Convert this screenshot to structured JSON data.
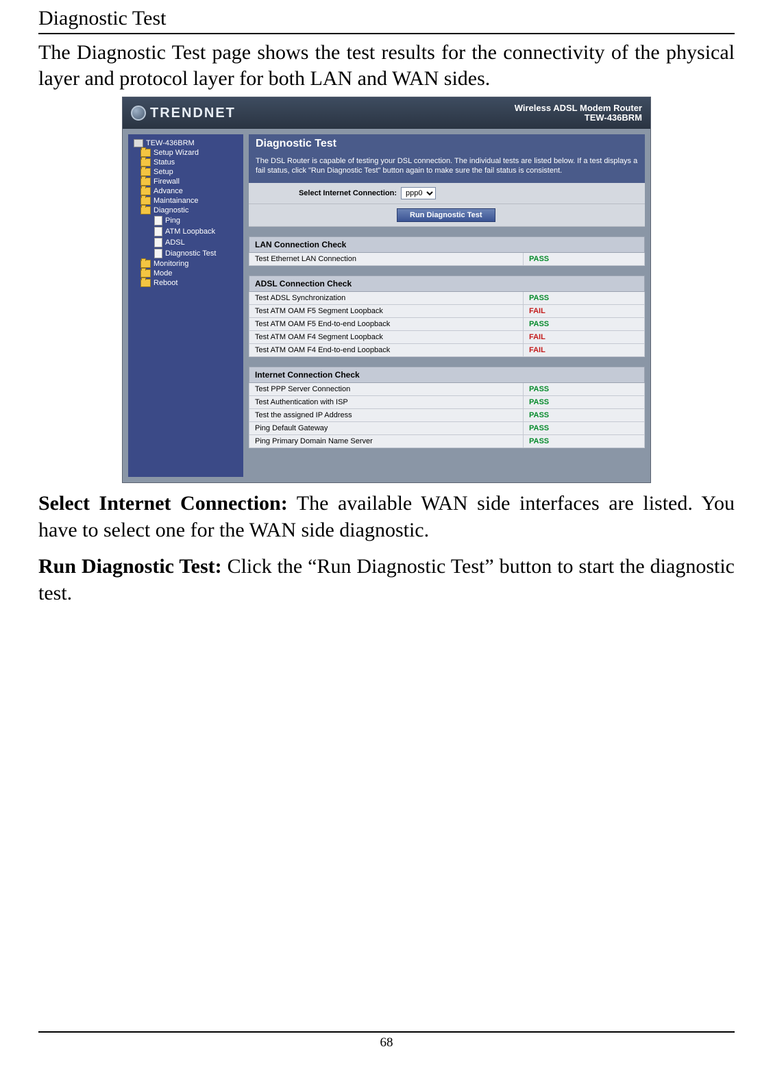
{
  "doc": {
    "section_heading": "Diagnostic Test",
    "intro": "The Diagnostic Test page shows the test results for the connectivity of the physical layer and protocol layer for both LAN and WAN sides.",
    "def1_term": "Select Internet Connection:",
    "def1_text": " The available WAN side interfaces are listed. You have to select one for the WAN side diagnostic.",
    "def2_term": "Run Diagnostic Test:",
    "def2_text": " Click the “Run Diagnostic Test” button to start the diagnostic test.",
    "page_number": "68"
  },
  "router": {
    "brand": "TRENDNET",
    "product_line1": "Wireless ADSL Modem Router",
    "product_line2": "TEW-436BRM",
    "nav": {
      "root": "TEW-436BRM",
      "items": [
        {
          "label": "Setup Wizard",
          "level": 1,
          "icon": "folder"
        },
        {
          "label": "Status",
          "level": 1,
          "icon": "folder"
        },
        {
          "label": "Setup",
          "level": 1,
          "icon": "folder"
        },
        {
          "label": "Firewall",
          "level": 1,
          "icon": "folder"
        },
        {
          "label": "Advance",
          "level": 1,
          "icon": "folder"
        },
        {
          "label": "Maintainance",
          "level": 1,
          "icon": "folder"
        },
        {
          "label": "Diagnostic",
          "level": 1,
          "icon": "folder"
        },
        {
          "label": "Ping",
          "level": 2,
          "icon": "page"
        },
        {
          "label": "ATM Loopback",
          "level": 2,
          "icon": "page"
        },
        {
          "label": "ADSL",
          "level": 2,
          "icon": "page"
        },
        {
          "label": "Diagnostic Test",
          "level": 2,
          "icon": "page"
        },
        {
          "label": "Monitoring",
          "level": 1,
          "icon": "folder"
        },
        {
          "label": "Mode",
          "level": 1,
          "icon": "folder"
        },
        {
          "label": "Reboot",
          "level": 1,
          "icon": "folder"
        }
      ]
    },
    "panel": {
      "title": "Diagnostic Test",
      "description": "The DSL Router is capable of testing your DSL connection. The individual tests are listed below. If a test displays a fail status, click \"Run Diagnostic Test\" button again to make sure the fail status is consistent.",
      "select_label": "Select Internet Connection:",
      "select_value": "ppp0",
      "run_button": "Run Diagnostic Test"
    },
    "sections": [
      {
        "heading": "LAN Connection Check",
        "rows": [
          {
            "name": "Test Ethernet LAN Connection",
            "status": "PASS"
          }
        ]
      },
      {
        "heading": "ADSL Connection Check",
        "rows": [
          {
            "name": "Test ADSL Synchronization",
            "status": "PASS"
          },
          {
            "name": "Test ATM OAM F5 Segment Loopback",
            "status": "FAIL"
          },
          {
            "name": "Test ATM OAM F5 End-to-end Loopback",
            "status": "PASS"
          },
          {
            "name": "Test ATM OAM F4 Segment Loopback",
            "status": "FAIL"
          },
          {
            "name": "Test ATM OAM F4 End-to-end Loopback",
            "status": "FAIL"
          }
        ]
      },
      {
        "heading": "Internet Connection Check",
        "rows": [
          {
            "name": "Test PPP Server Connection",
            "status": "PASS"
          },
          {
            "name": "Test Authentication with ISP",
            "status": "PASS"
          },
          {
            "name": "Test the assigned IP Address",
            "status": "PASS"
          },
          {
            "name": "Ping Default Gateway",
            "status": "PASS"
          },
          {
            "name": "Ping Primary Domain Name Server",
            "status": "PASS"
          }
        ]
      }
    ]
  }
}
